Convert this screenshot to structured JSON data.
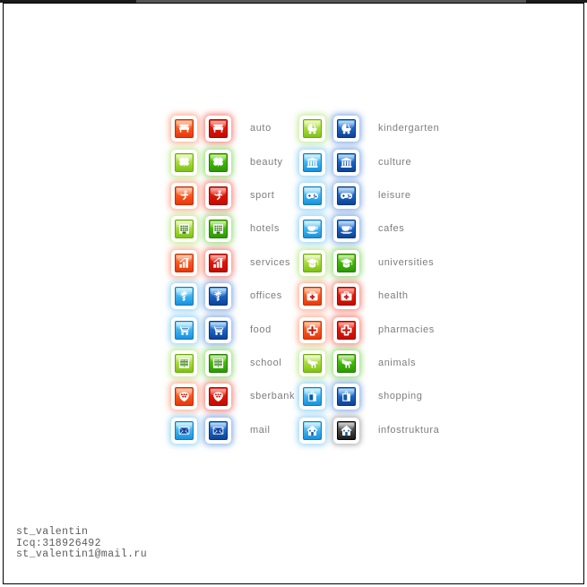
{
  "page": {
    "background_color": "#ffffff",
    "frame_color": "#000000",
    "label_color": "#7d7d7d",
    "topbar": {
      "left_color": "#1b1b1b",
      "mid_color": "#565656",
      "right_color": "#1b1b1b"
    }
  },
  "icon_set": {
    "columns": [
      {
        "name": "left-column",
        "rows": [
          {
            "label": "auto",
            "icon": "bench-icon",
            "left_color": "red-soft",
            "right_color": "red-solid"
          },
          {
            "label": "beauty",
            "icon": "butterfly-icon",
            "left_color": "green-soft",
            "right_color": "green-solid"
          },
          {
            "label": "sport",
            "icon": "runner-icon",
            "left_color": "red-soft",
            "right_color": "red-solid"
          },
          {
            "label": "hotels",
            "icon": "building-icon",
            "left_color": "green-soft",
            "right_color": "green-solid"
          },
          {
            "label": "services",
            "icon": "bar-chart-icon",
            "left_color": "red-soft",
            "right_color": "red-solid"
          },
          {
            "label": "offices",
            "icon": "double-eagle-icon",
            "left_color": "blue-soft",
            "right_color": "blue-solid"
          },
          {
            "label": "food",
            "icon": "shopping-cart-icon",
            "left_color": "blue-soft",
            "right_color": "blue-solid"
          },
          {
            "label": "school",
            "icon": "open-book-icon",
            "left_color": "green-soft",
            "right_color": "green-solid"
          },
          {
            "label": "sberbank",
            "icon": "wallet-purse-icon",
            "left_color": "red-soft",
            "right_color": "red-solid"
          },
          {
            "label": "mail",
            "icon": "envelope-icon",
            "left_color": "blue-soft",
            "right_color": "blue-solid"
          }
        ]
      },
      {
        "name": "right-column",
        "rows": [
          {
            "label": "kindergarten",
            "icon": "baby-stroller-icon",
            "left_color": "green-soft",
            "right_color": "blue-solid"
          },
          {
            "label": "culture",
            "icon": "greek-column-icon",
            "left_color": "blue-soft",
            "right_color": "blue-solid"
          },
          {
            "label": "leisure",
            "icon": "gamepad-icon",
            "left_color": "blue-soft",
            "right_color": "blue-solid"
          },
          {
            "label": "cafes",
            "icon": "coffee-cup-icon",
            "left_color": "blue-soft",
            "right_color": "blue-solid"
          },
          {
            "label": "universities",
            "icon": "graduation-cap-icon",
            "left_color": "green-soft",
            "right_color": "green-solid"
          },
          {
            "label": "health",
            "icon": "first-aid-kit-icon",
            "left_color": "red-soft",
            "right_color": "red-solid"
          },
          {
            "label": "pharmacies",
            "icon": "medical-cross-icon",
            "left_color": "red-soft",
            "right_color": "red-solid"
          },
          {
            "label": "animals",
            "icon": "dog-icon",
            "left_color": "green-soft",
            "right_color": "green-solid"
          },
          {
            "label": "shopping",
            "icon": "shopping-bag-icon",
            "left_color": "blue-soft",
            "right_color": "blue-solid"
          },
          {
            "label": "infostruktura",
            "icon": "house-icon",
            "left_color": "blue-soft",
            "right_color": "dark-solid"
          }
        ]
      }
    ]
  },
  "credits": {
    "line1": "st_valentin",
    "line2": "Icq:318926492",
    "line3": "st_valentin1@mail.ru"
  }
}
